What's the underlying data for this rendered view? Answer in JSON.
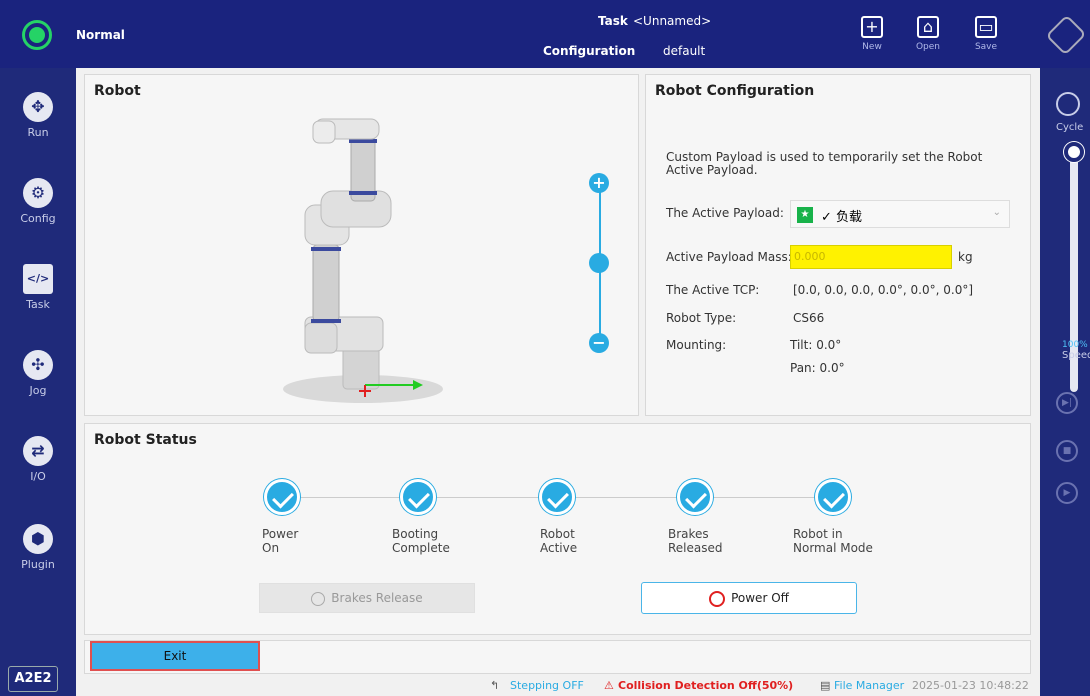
{
  "header": {
    "status": "Normal",
    "task_label": "Task",
    "task_value": "<Unnamed>",
    "config_label": "Configuration",
    "config_value": "default",
    "new_label": "New",
    "open_label": "Open",
    "save_label": "Save"
  },
  "sidebar": {
    "items": [
      {
        "label": "Run",
        "icon": "run-icon"
      },
      {
        "label": "Config",
        "icon": "gear-icon"
      },
      {
        "label": "Task",
        "icon": "code-icon"
      },
      {
        "label": "Jog",
        "icon": "move-icon"
      },
      {
        "label": "I/O",
        "icon": "io-icon"
      },
      {
        "label": "Plugin",
        "icon": "cube-icon"
      }
    ],
    "badge": "A2E2"
  },
  "rightbar": {
    "cycle_label": "Cycle",
    "speed_pct": "100%",
    "speed_label": "Speed",
    "speed_level": 1.0
  },
  "robot_panel": {
    "title": "Robot"
  },
  "config_panel": {
    "title": "Robot Configuration",
    "description": "Custom Payload is used to temporarily set the Robot Active Payload.",
    "payload_label": "The Active Payload:",
    "payload_value": "✓ 负载",
    "mass_label": "Active Payload Mass:",
    "mass_placeholder": "0.000",
    "mass_unit": "kg",
    "tcp_label": "The Active TCP:",
    "tcp_value": "[0.0, 0.0, 0.0, 0.0°, 0.0°, 0.0°]",
    "type_label": "Robot Type:",
    "type_value": "CS66",
    "mounting_label": "Mounting:",
    "tilt_value": "Tilt: 0.0°",
    "pan_value": "Pan: 0.0°"
  },
  "status_panel": {
    "title": "Robot Status",
    "steps": [
      {
        "line1": "Power",
        "line2": "On"
      },
      {
        "line1": "Booting",
        "line2": "Complete"
      },
      {
        "line1": "Robot",
        "line2": "Active"
      },
      {
        "line1": "Brakes",
        "line2": "Released"
      },
      {
        "line1": "Robot in",
        "line2": "Normal Mode"
      }
    ],
    "brakes_release_label": "Brakes Release",
    "power_off_label": "Power Off"
  },
  "exit_label": "Exit",
  "footer": {
    "stepping": "Stepping OFF",
    "collision": "Collision Detection Off(50%)",
    "file_manager": "File Manager",
    "datetime": "2025-01-23 10:48:22"
  },
  "colors": {
    "nav_bg": "#1f2a7a",
    "accent": "#29abe2",
    "status_ok": "#25d366",
    "warn": "#e02020",
    "mass_bg": "#fff200"
  }
}
